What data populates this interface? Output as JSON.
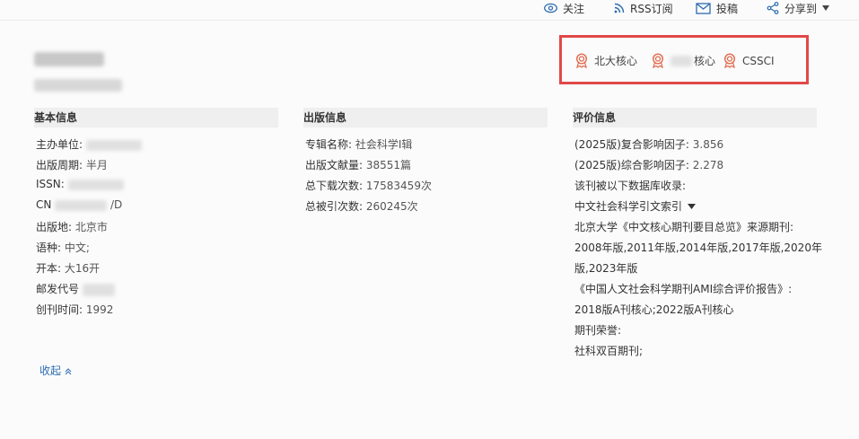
{
  "topbar": {
    "follow": "关注",
    "rss": "RSS订阅",
    "submit": "投稿",
    "share": "分享到"
  },
  "badges": [
    {
      "label": "北大核心"
    },
    {
      "label": "核心"
    },
    {
      "label": "CSSCI"
    }
  ],
  "basic": {
    "heading": "基本信息",
    "sponsor_label": "主办单位:",
    "cycle_label": "出版周期:",
    "cycle_value": "半月",
    "issn_label": "ISSN:",
    "cn_label": "CN",
    "cn_tail": "/D",
    "place_label": "出版地:",
    "place_value": "北京市",
    "lang_label": "语种:",
    "lang_value": "中文;",
    "format_label": "开本:",
    "format_value": "大16开",
    "postal_label": "邮发代号",
    "founded_label": "创刊时间:",
    "founded_value": "1992"
  },
  "publish": {
    "heading": "出版信息",
    "album_label": "专辑名称:",
    "album_value": "社会科学Ⅰ辑",
    "docs_label": "出版文献量:",
    "docs_value": "38551篇",
    "downloads_label": "总下载次数:",
    "downloads_value": "17583459次",
    "cites_label": "总被引次数:",
    "cites_value": "260245次"
  },
  "evaluation": {
    "heading": "评价信息",
    "if_composite": "(2025版)复合影响因子:",
    "if_composite_value": "3.856",
    "if_comprehensive": "(2025版)综合影响因子:",
    "if_comprehensive_value": "2.278",
    "db_intro": "该刊被以下数据库收录:",
    "db_select": "中文社会科学引文索引",
    "pku_intro": "北京大学《中文核心期刊要目总览》来源期刊:",
    "pku_years_1": "2008年版,2011年版,2014年版,2017年版,2020年",
    "pku_years_2": "版,2023年版",
    "ami_intro": "《中国人文社会科学期刊AMI综合评价报告》:",
    "ami_value": "2018版A刊核心;2022版A刊核心",
    "honor_label": "期刊荣誉:",
    "honor_value": "社科双百期刊;"
  },
  "collapse_label": "收起"
}
